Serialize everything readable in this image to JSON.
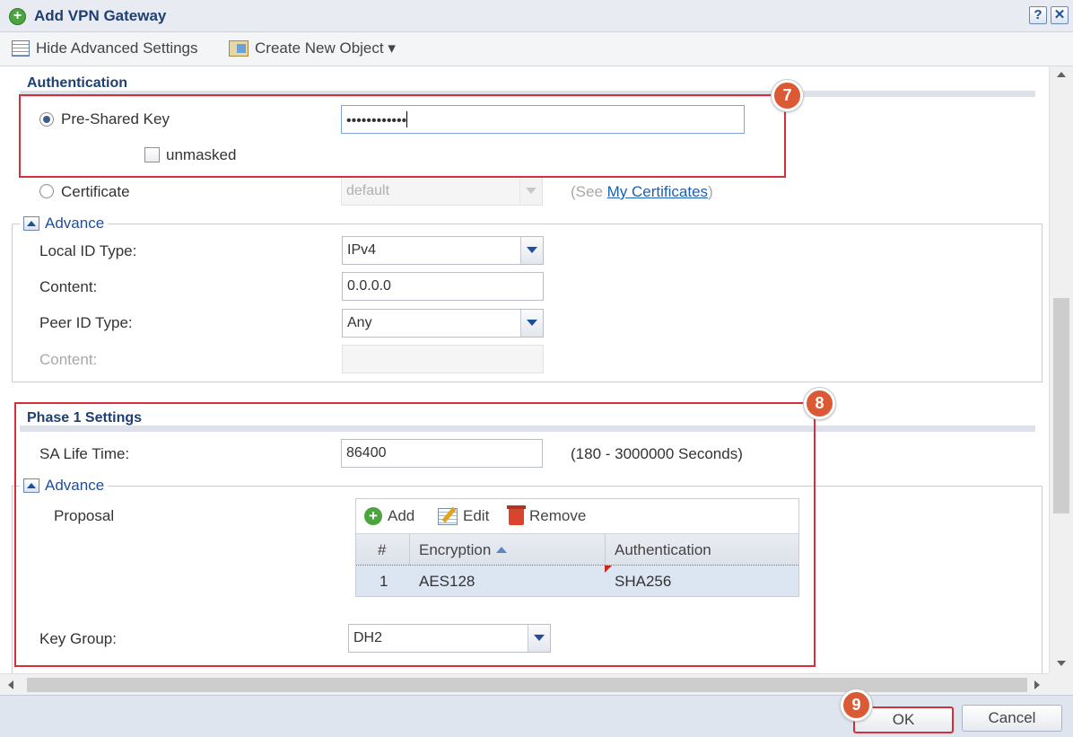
{
  "window": {
    "title": "Add VPN Gateway",
    "help_label": "?",
    "close_label": "✕"
  },
  "toolbar": {
    "hide_advanced": "Hide Advanced Settings",
    "create_new_object": "Create New Object ▾"
  },
  "authentication": {
    "section_title": "Authentication",
    "pre_shared_key_label": "Pre-Shared Key",
    "pre_shared_key_value": "••••••••••••",
    "pre_shared_key_selected": true,
    "unmasked_label": "unmasked",
    "unmasked_checked": false,
    "certificate_label": "Certificate",
    "certificate_value": "default",
    "certificate_hint_open": "(See ",
    "certificate_link": "My Certificates",
    "certificate_hint_close": ")",
    "advance": {
      "legend": "Advance",
      "local_id_type_label": "Local ID Type:",
      "local_id_type_value": "IPv4",
      "content_label": "Content:",
      "content_value": "0.0.0.0",
      "peer_id_type_label": "Peer ID Type:",
      "peer_id_type_value": "Any",
      "peer_content_label": "Content:",
      "peer_content_value": ""
    }
  },
  "phase1": {
    "section_title": "Phase 1 Settings",
    "sa_life_time_label": "SA Life Time:",
    "sa_life_time_value": "86400",
    "sa_life_time_hint": "(180 - 3000000 Seconds)",
    "advance": {
      "legend": "Advance",
      "proposal_label": "Proposal",
      "grid_tools": {
        "add": "Add",
        "edit": "Edit",
        "remove": "Remove"
      },
      "columns": [
        "#",
        "Encryption",
        "Authentication"
      ],
      "rows": [
        {
          "num": "1",
          "encryption": "AES128",
          "authentication": "SHA256"
        }
      ],
      "key_group_label": "Key Group:",
      "key_group_value": "DH2"
    }
  },
  "callouts": [
    "7",
    "8",
    "9"
  ],
  "footer": {
    "ok_label": "OK",
    "cancel_label": "Cancel"
  },
  "colors": {
    "callout_red": "#d3303c",
    "badge_orange": "#db5a35",
    "title_blue": "#1f3f73",
    "link_blue": "#1f5fae"
  }
}
